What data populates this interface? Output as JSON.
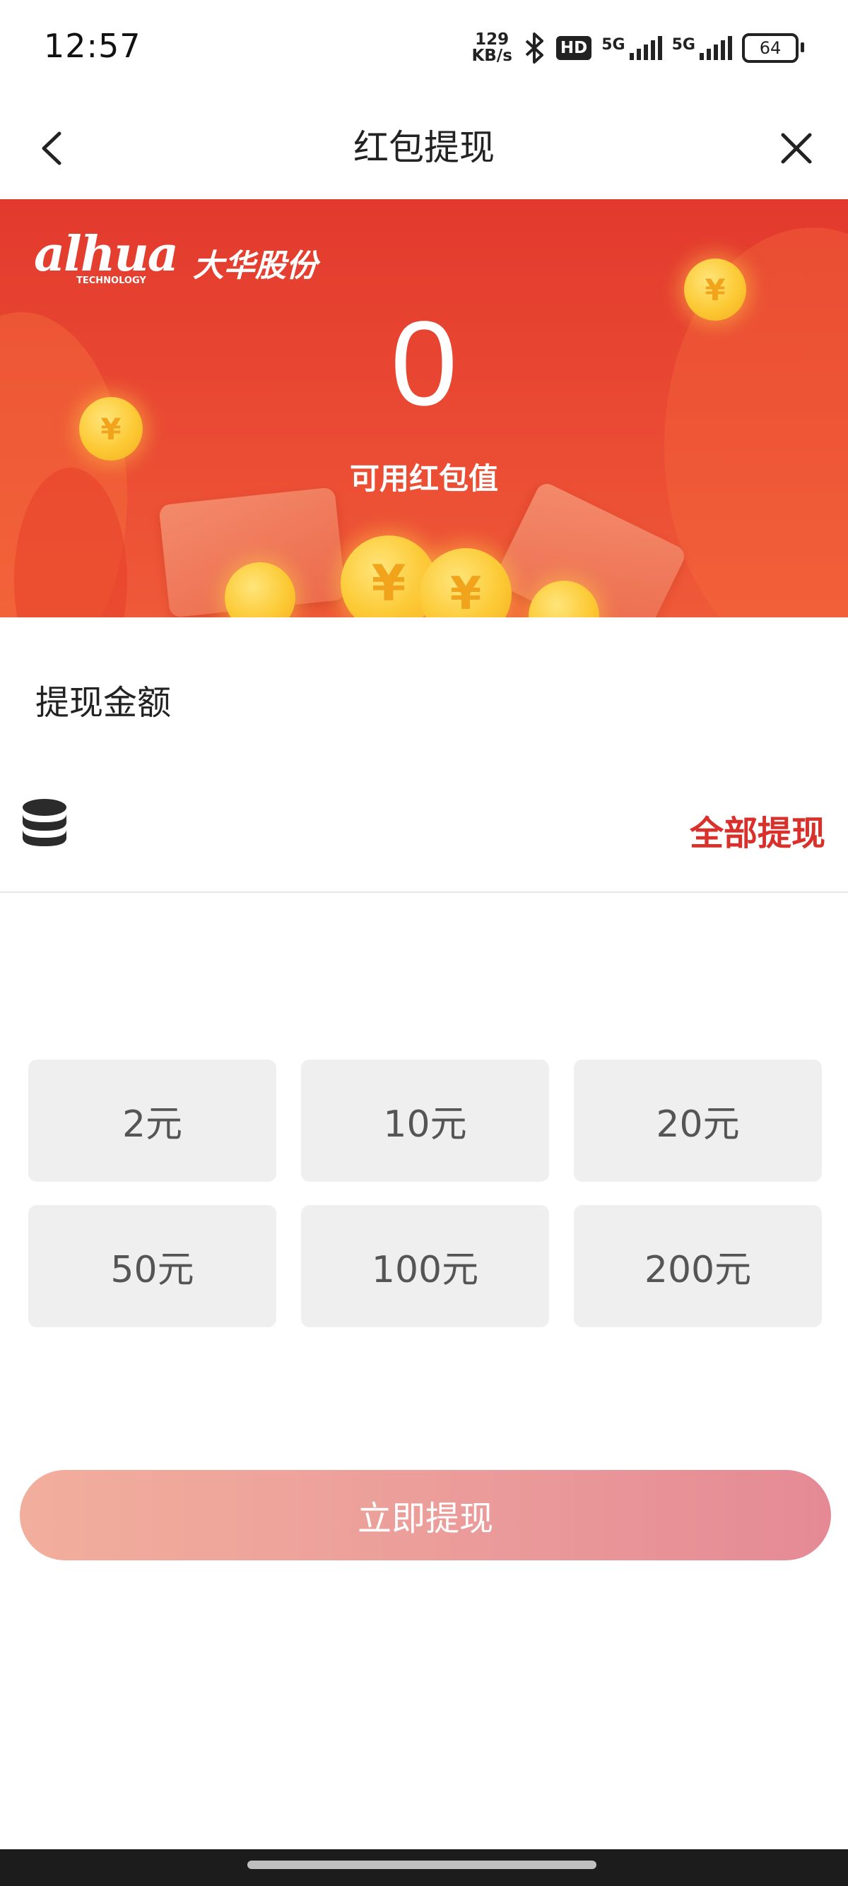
{
  "status_bar": {
    "time": "12:57",
    "net_speed_value": "129",
    "net_speed_unit": "KB/s",
    "hd_label": "HD",
    "sim1_label": "5G",
    "sim2_label": "5G",
    "battery": "64"
  },
  "nav": {
    "title": "红包提现",
    "back_icon": "chevron-left-icon",
    "close_icon": "close-icon"
  },
  "banner": {
    "logo_text": "alhua",
    "logo_subtext": "TECHNOLOGY",
    "logo_cn": "大华股份",
    "balance": "0",
    "balance_label": "可用红包值",
    "coin_symbol": "¥"
  },
  "amount_section": {
    "label": "提现金额",
    "input_icon": "coins-stack-icon",
    "withdraw_all": "全部提现"
  },
  "amount_options": [
    "2元",
    "10元",
    "20元",
    "50元",
    "100元",
    "200元"
  ],
  "submit": {
    "label": "立即提现"
  },
  "colors": {
    "accent_red": "#d9302b",
    "banner_red": "#e23a2e",
    "button_gradient_start": "#f2ae9c",
    "button_gradient_end": "#e58a95",
    "chip_bg": "#efefef"
  }
}
